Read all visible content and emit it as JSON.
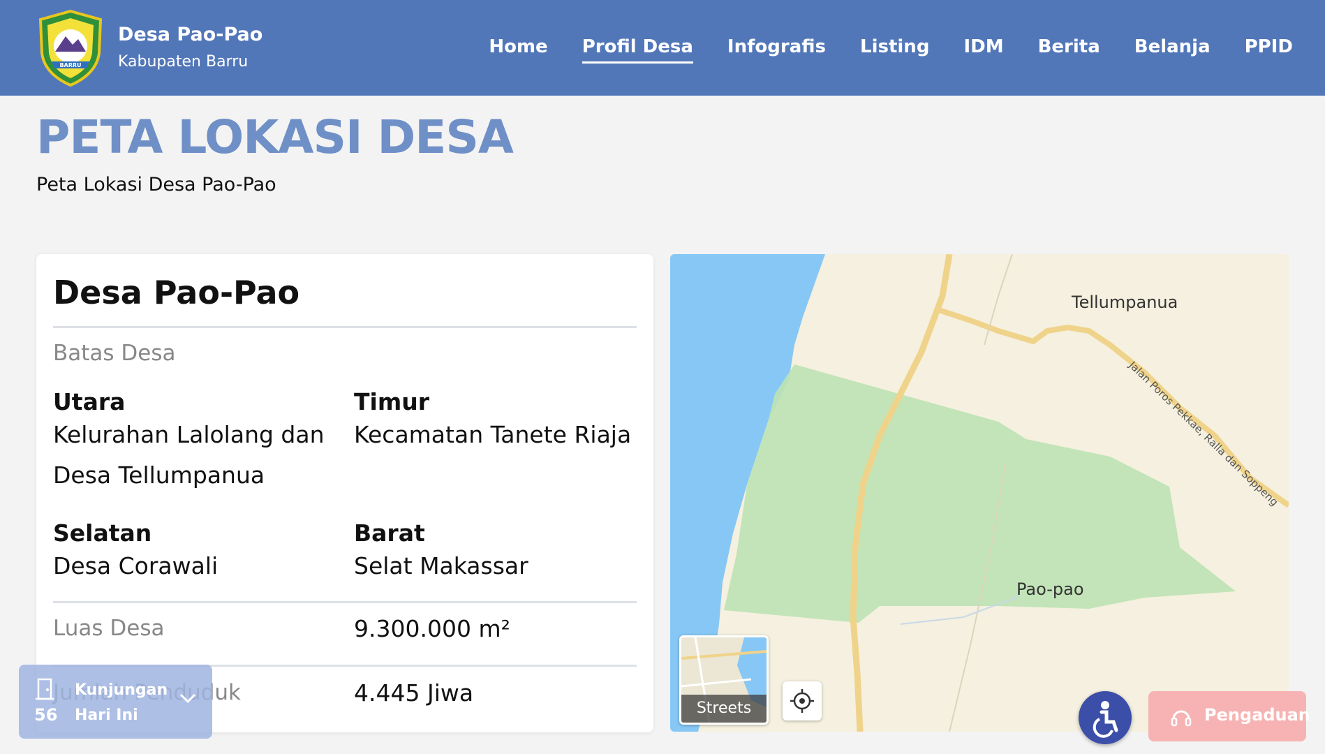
{
  "header": {
    "brand_title": "Desa Pao-Pao",
    "brand_subtitle": "Kabupaten Barru",
    "logo_text": "BARRU",
    "nav": [
      "Home",
      "Profil Desa",
      "Infografis",
      "Listing",
      "IDM",
      "Berita",
      "Belanja",
      "PPID"
    ],
    "active_nav": "Profil Desa"
  },
  "page": {
    "title": "PETA LOKASI DESA",
    "subtitle": "Peta Lokasi Desa Pao-Pao"
  },
  "card": {
    "title": "Desa Pao-Pao",
    "boundaries_heading": "Batas Desa",
    "north_label": "Utara",
    "north_value_line1": "Kelurahan Lalolang dan",
    "north_value_line2": "Desa Tellumpanua",
    "east_label": "Timur",
    "east_value": "Kecamatan Tanete Riaja",
    "south_label": "Selatan",
    "south_value": "Desa Corawali",
    "west_label": "Barat",
    "west_value": "Selat Makassar",
    "area_label": "Luas Desa",
    "area_value": "9.300.000 m²",
    "population_label": "Jumlah Penduduk",
    "population_value": "4.445 Jiwa"
  },
  "map": {
    "label_tellumpanua": "Tellumpanua",
    "label_paopao": "Pao-pao",
    "road_label": "Jalan Poros Pekkae, Ralla dan Soppeng",
    "streets_label": "Streets",
    "colors": {
      "sea": "#86c7f5",
      "land": "#f5f0df",
      "village": "#bde3b4",
      "road": "#f0d38a"
    }
  },
  "widgets": {
    "visits_count": "56",
    "visits_label1": "Kunjungan",
    "visits_label2": "Hari Ini",
    "complaint_label": "Pengaduan"
  },
  "colors": {
    "header_bg": "#5277b9",
    "title_color": "#6f8fc7"
  }
}
